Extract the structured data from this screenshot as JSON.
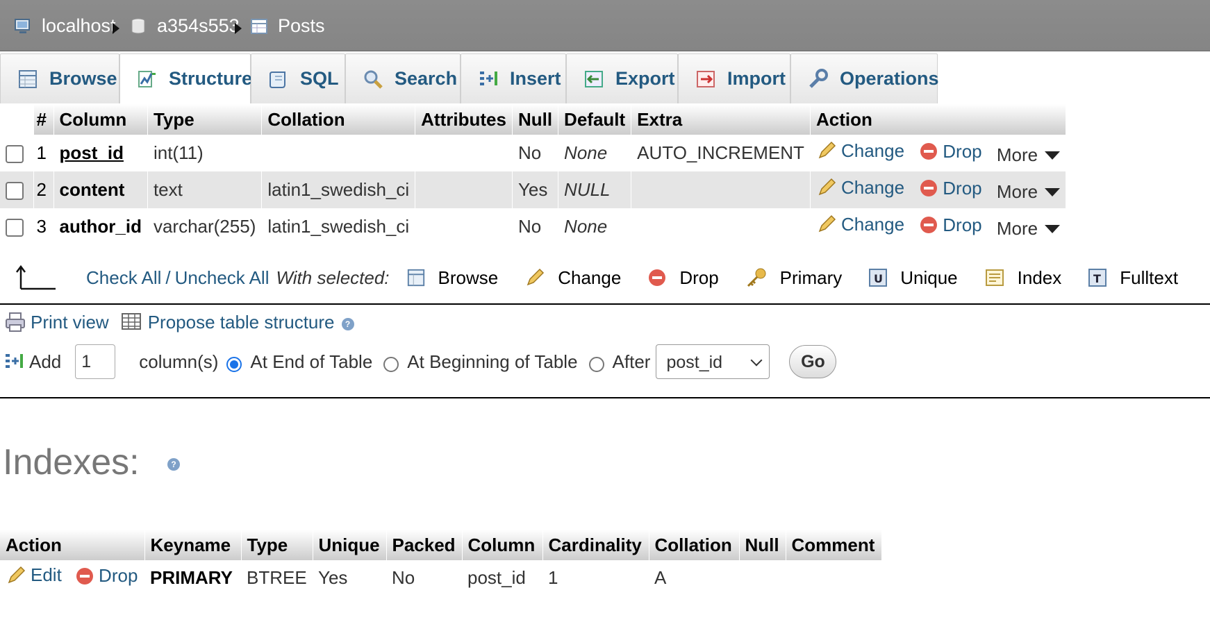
{
  "breadcrumb": {
    "server": "localhost",
    "database": "a354s553",
    "table": "Posts"
  },
  "tabs": [
    {
      "label": "Browse",
      "icon": "browse-icon"
    },
    {
      "label": "Structure",
      "icon": "structure-icon",
      "active": true
    },
    {
      "label": "SQL",
      "icon": "sql-icon"
    },
    {
      "label": "Search",
      "icon": "search-icon"
    },
    {
      "label": "Insert",
      "icon": "insert-icon"
    },
    {
      "label": "Export",
      "icon": "export-icon"
    },
    {
      "label": "Import",
      "icon": "import-icon"
    },
    {
      "label": "Operations",
      "icon": "operations-icon"
    }
  ],
  "structure": {
    "headers": [
      "#",
      "Column",
      "Type",
      "Collation",
      "Attributes",
      "Null",
      "Default",
      "Extra",
      "Action"
    ],
    "rows": [
      {
        "num": "1",
        "column": "post_id",
        "type": "int(11)",
        "collation": "",
        "attributes": "",
        "null": "No",
        "default": "None",
        "extra": "AUTO_INCREMENT"
      },
      {
        "num": "2",
        "column": "content",
        "type": "text",
        "collation": "latin1_swedish_ci",
        "attributes": "",
        "null": "Yes",
        "default": "NULL",
        "extra": ""
      },
      {
        "num": "3",
        "column": "author_id",
        "type": "varchar(255)",
        "collation": "latin1_swedish_ci",
        "attributes": "",
        "null": "No",
        "default": "None",
        "extra": ""
      }
    ],
    "actions": {
      "change": "Change",
      "drop": "Drop",
      "more": "More"
    }
  },
  "check": {
    "check_all": "Check All",
    "slash": "/",
    "uncheck_all": "Uncheck All",
    "with_selected": "With selected:",
    "actions": [
      "Browse",
      "Change",
      "Drop",
      "Primary",
      "Unique",
      "Index",
      "Fulltext"
    ]
  },
  "tools": {
    "print_view": "Print view",
    "propose": "Propose table structure",
    "add": "Add",
    "add_count": "1",
    "columns": "column(s)",
    "at_end": "At End of Table",
    "at_beginning": "At Beginning of Table",
    "after": "After",
    "after_value": "post_id",
    "go": "Go"
  },
  "indexes": {
    "title": "Indexes:",
    "headers": [
      "Action",
      "Keyname",
      "Type",
      "Unique",
      "Packed",
      "Column",
      "Cardinality",
      "Collation",
      "Null",
      "Comment"
    ],
    "rows": [
      {
        "edit": "Edit",
        "drop": "Drop",
        "keyname": "PRIMARY",
        "type": "BTREE",
        "unique": "Yes",
        "packed": "No",
        "column": "post_id",
        "cardinality": "1",
        "collation": "A",
        "null": "",
        "comment": ""
      }
    ]
  }
}
